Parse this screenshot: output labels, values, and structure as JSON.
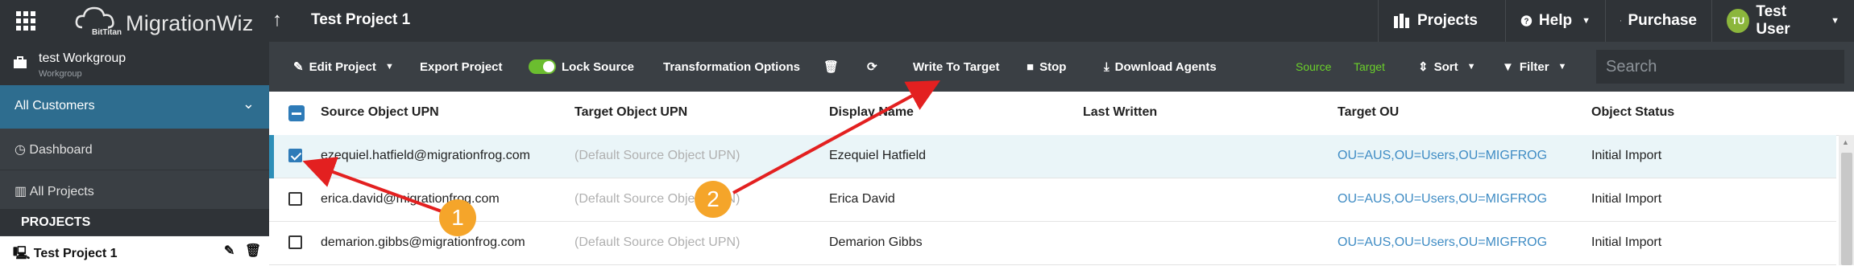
{
  "app": {
    "name": "MigrationWiz",
    "sub": "BitTitan"
  },
  "header": {
    "project_title": "Test Project 1",
    "projects": "Projects",
    "help": "Help",
    "purchase": "Purchase",
    "user_initials": "TU",
    "user_name": "Test User"
  },
  "sidebar": {
    "workgroup_name": "test Workgroup",
    "workgroup_sub": "Workgroup",
    "all_customers": "All Customers",
    "dashboard": "Dashboard",
    "all_projects": "All Projects",
    "projects_header": "PROJECTS",
    "project_item": "Test Project 1"
  },
  "toolbar": {
    "edit_project": "Edit Project",
    "export_project": "Export Project",
    "lock_source": "Lock Source",
    "transformation_options": "Transformation Options",
    "write_to_target": "Write To Target",
    "stop": "Stop",
    "download_agents": "Download Agents",
    "source": "Source",
    "target": "Target",
    "sort": "Sort",
    "filter": "Filter",
    "search_placeholder": "Search"
  },
  "table": {
    "columns": [
      "Source Object UPN",
      "Target Object UPN",
      "Display Name",
      "Last Written",
      "Target OU",
      "Object Status"
    ],
    "rows": [
      {
        "source": "ezequiel.hatfield@migrationfrog.com",
        "target": "(Default Source Object UPN)",
        "display": "Ezequiel Hatfield",
        "last": "",
        "ou": "OU=AUS,OU=Users,OU=MIGFROG",
        "status": "Initial Import",
        "checked": true
      },
      {
        "source": "erica.david@migrationfrog.com",
        "target": "(Default Source Object UPN)",
        "display": "Erica David",
        "last": "",
        "ou": "OU=AUS,OU=Users,OU=MIGFROG",
        "status": "Initial Import",
        "checked": false
      },
      {
        "source": "demarion.gibbs@migrationfrog.com",
        "target": "(Default Source Object UPN)",
        "display": "Demarion Gibbs",
        "last": "",
        "ou": "OU=AUS,OU=Users,OU=MIGFROG",
        "status": "Initial Import",
        "checked": false
      }
    ]
  },
  "annotations": {
    "badge1": "1",
    "badge2": "2"
  },
  "colors": {
    "accent": "#2e6d8f",
    "arrow": "#e32020",
    "badge": "#f5a52a",
    "toggle": "#6bbd2f"
  }
}
